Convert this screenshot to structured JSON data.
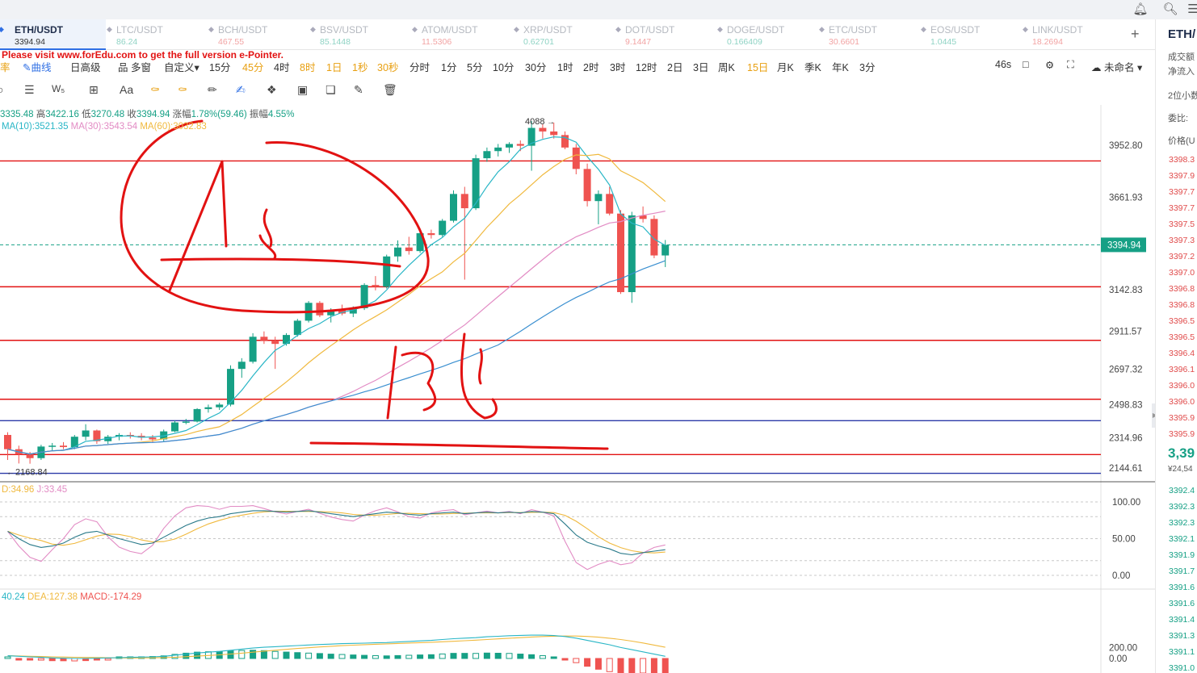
{
  "promo_text": "Please visit www.forEdu.com to get the full version e-Pointer.",
  "tabs": [
    {
      "symbol": "ETH/USDT",
      "price": "3394.94",
      "active": true
    },
    {
      "symbol": "LTC/USDT",
      "price": "86.24"
    },
    {
      "symbol": "BCH/USDT",
      "price": "467.55"
    },
    {
      "symbol": "BSV/USDT",
      "price": "85.1448"
    },
    {
      "symbol": "ATOM/USDT",
      "price": "11.5306"
    },
    {
      "symbol": "XRP/USDT",
      "price": "0.62701"
    },
    {
      "symbol": "DOT/USDT",
      "price": "9.1447"
    },
    {
      "symbol": "DOGE/USDT",
      "price": "0.166409"
    },
    {
      "symbol": "ETC/USDT",
      "price": "30.6601"
    },
    {
      "symbol": "EOS/USDT",
      "price": "1.0445"
    },
    {
      "symbol": "LINK/USDT",
      "price": "18.2694"
    }
  ],
  "intervals": {
    "left_partial": "率",
    "curve": "曲线",
    "advanced": "日高级",
    "multi": "品 多窗",
    "custom": "自定义",
    "items": [
      "15分",
      "45分",
      "4时",
      "8时",
      "1日",
      "1秒",
      "30秒",
      "分时",
      "1分",
      "5分",
      "10分",
      "30分",
      "1时",
      "2时",
      "3时",
      "12时",
      "2日",
      "3日",
      "周K",
      "15日",
      "月K",
      "季K",
      "年K",
      "3分"
    ],
    "highlighted": [
      "45分",
      "8时",
      "1日",
      "1秒",
      "30秒",
      "15日"
    ],
    "countdown": "46s",
    "layout_name": "未命名"
  },
  "ohlc_info": {
    "open": "3335.48",
    "high_label": "高",
    "high": "3422.16",
    "low_label": "低",
    "low": "3270.48",
    "close_label": "收",
    "close": "3394.94",
    "change_label": "涨幅",
    "change": "1.78%(59.46)",
    "amp_label": "振幅",
    "amp": "4.55%"
  },
  "ma_info": {
    "ma10": "MA(10):3521.35",
    "ma30": "MA(30):3543.54",
    "ma60": "MA(60):3032.83"
  },
  "kdj_info": {
    "d": "D:34.96",
    "j": "J:33.45"
  },
  "macd_info": {
    "dif": "40.24",
    "dea": "DEA:127.38",
    "macd": "MACD:-174.29"
  },
  "price_axis": [
    "3952.80",
    "3661.93",
    "3142.83",
    "2911.57",
    "2697.32",
    "2498.83",
    "2314.96",
    "2144.61"
  ],
  "current_price": "3394.94",
  "high_marker": "4088",
  "low_marker": "2168.84",
  "kdj_axis": [
    "100.00",
    "50.00",
    "0.00"
  ],
  "macd_axis": [
    "200.00",
    "0.00"
  ],
  "colors": {
    "up": "#16a085",
    "down": "#ef5350",
    "ma10": "#29b6c6",
    "ma30": "#f0b93e",
    "ma60": "#e28bc4",
    "annotation": "#e21212",
    "hline_blue": "#2b3aa8"
  },
  "right_panel": {
    "title": "ETH/",
    "labels": [
      "成交额",
      "净流入"
    ],
    "decimals": "2位小数",
    "commission": "委比:",
    "price_header": "价格(U",
    "asks": [
      "3398.3",
      "3397.9",
      "3397.7",
      "3397.7",
      "3397.5",
      "3397.3",
      "3397.2",
      "3397.0",
      "3396.8",
      "3396.8",
      "3396.5",
      "3396.5",
      "3396.4",
      "3396.1",
      "3396.0",
      "3396.0",
      "3395.9",
      "3395.9"
    ],
    "last": "3,39",
    "last_sub": "¥24,54",
    "bids": [
      "3392.4",
      "3392.3",
      "3392.3",
      "3392.1",
      "3391.9",
      "3391.7",
      "3391.6",
      "3391.6",
      "3391.4",
      "3391.3",
      "3391.1",
      "3391.0"
    ]
  },
  "chart_data": {
    "type": "candlestick",
    "symbol": "ETH/USDT",
    "candles": [
      {
        "o": 2330,
        "h": 2345,
        "l": 2190,
        "c": 2250
      },
      {
        "o": 2250,
        "h": 2270,
        "l": 2170,
        "c": 2220
      },
      {
        "o": 2220,
        "h": 2235,
        "l": 2168.84,
        "c": 2200
      },
      {
        "o": 2200,
        "h": 2275,
        "l": 2190,
        "c": 2265
      },
      {
        "o": 2265,
        "h": 2285,
        "l": 2240,
        "c": 2270
      },
      {
        "o": 2270,
        "h": 2290,
        "l": 2250,
        "c": 2262
      },
      {
        "o": 2262,
        "h": 2330,
        "l": 2250,
        "c": 2320
      },
      {
        "o": 2320,
        "h": 2390,
        "l": 2300,
        "c": 2355
      },
      {
        "o": 2355,
        "h": 2360,
        "l": 2280,
        "c": 2295
      },
      {
        "o": 2295,
        "h": 2330,
        "l": 2280,
        "c": 2320
      },
      {
        "o": 2320,
        "h": 2340,
        "l": 2300,
        "c": 2330
      },
      {
        "o": 2330,
        "h": 2345,
        "l": 2310,
        "c": 2325
      },
      {
        "o": 2325,
        "h": 2340,
        "l": 2300,
        "c": 2315
      },
      {
        "o": 2315,
        "h": 2330,
        "l": 2290,
        "c": 2305
      },
      {
        "o": 2305,
        "h": 2360,
        "l": 2290,
        "c": 2350
      },
      {
        "o": 2350,
        "h": 2410,
        "l": 2345,
        "c": 2400
      },
      {
        "o": 2400,
        "h": 2420,
        "l": 2390,
        "c": 2405
      },
      {
        "o": 2405,
        "h": 2480,
        "l": 2400,
        "c": 2475
      },
      {
        "o": 2475,
        "h": 2500,
        "l": 2455,
        "c": 2485
      },
      {
        "o": 2485,
        "h": 2510,
        "l": 2470,
        "c": 2500
      },
      {
        "o": 2500,
        "h": 2720,
        "l": 2490,
        "c": 2700
      },
      {
        "o": 2700,
        "h": 2760,
        "l": 2650,
        "c": 2740
      },
      {
        "o": 2740,
        "h": 2900,
        "l": 2730,
        "c": 2880
      },
      {
        "o": 2880,
        "h": 2910,
        "l": 2840,
        "c": 2860
      },
      {
        "o": 2860,
        "h": 2880,
        "l": 2700,
        "c": 2840
      },
      {
        "o": 2840,
        "h": 2900,
        "l": 2830,
        "c": 2890
      },
      {
        "o": 2890,
        "h": 2980,
        "l": 2880,
        "c": 2970
      },
      {
        "o": 2970,
        "h": 3080,
        "l": 2960,
        "c": 3070
      },
      {
        "o": 3070,
        "h": 3080,
        "l": 2990,
        "c": 3000
      },
      {
        "o": 3000,
        "h": 3040,
        "l": 2960,
        "c": 3030
      },
      {
        "o": 3030,
        "h": 3060,
        "l": 3000,
        "c": 3010
      },
      {
        "o": 3010,
        "h": 3050,
        "l": 2990,
        "c": 3040
      },
      {
        "o": 3040,
        "h": 3180,
        "l": 3030,
        "c": 3170
      },
      {
        "o": 3170,
        "h": 3220,
        "l": 3140,
        "c": 3160
      },
      {
        "o": 3160,
        "h": 3340,
        "l": 3150,
        "c": 3330
      },
      {
        "o": 3330,
        "h": 3420,
        "l": 3300,
        "c": 3380
      },
      {
        "o": 3380,
        "h": 3440,
        "l": 3340,
        "c": 3360
      },
      {
        "o": 3360,
        "h": 3470,
        "l": 3350,
        "c": 3460
      },
      {
        "o": 3460,
        "h": 3480,
        "l": 3430,
        "c": 3450
      },
      {
        "o": 3450,
        "h": 3540,
        "l": 3440,
        "c": 3530
      },
      {
        "o": 3530,
        "h": 3700,
        "l": 3520,
        "c": 3680
      },
      {
        "o": 3680,
        "h": 3720,
        "l": 3200,
        "c": 3600
      },
      {
        "o": 3600,
        "h": 3900,
        "l": 3590,
        "c": 3880
      },
      {
        "o": 3880,
        "h": 3940,
        "l": 3860,
        "c": 3920
      },
      {
        "o": 3920,
        "h": 3960,
        "l": 3890,
        "c": 3940
      },
      {
        "o": 3940,
        "h": 3970,
        "l": 3910,
        "c": 3960
      },
      {
        "o": 3960,
        "h": 3980,
        "l": 3920,
        "c": 3950
      },
      {
        "o": 3950,
        "h": 4088,
        "l": 3810,
        "c": 4050
      },
      {
        "o": 4050,
        "h": 4070,
        "l": 3990,
        "c": 4030
      },
      {
        "o": 4030,
        "h": 4080,
        "l": 3990,
        "c": 4010
      },
      {
        "o": 4010,
        "h": 4030,
        "l": 3930,
        "c": 3940
      },
      {
        "o": 3940,
        "h": 3960,
        "l": 3790,
        "c": 3820
      },
      {
        "o": 3820,
        "h": 3850,
        "l": 3610,
        "c": 3640
      },
      {
        "o": 3640,
        "h": 3700,
        "l": 3510,
        "c": 3680
      },
      {
        "o": 3680,
        "h": 3720,
        "l": 3560,
        "c": 3570
      },
      {
        "o": 3570,
        "h": 3590,
        "l": 3120,
        "c": 3130
      },
      {
        "o": 3130,
        "h": 3580,
        "l": 3070,
        "c": 3560
      },
      {
        "o": 3560,
        "h": 3610,
        "l": 3520,
        "c": 3540
      },
      {
        "o": 3540,
        "h": 3560,
        "l": 3320,
        "c": 3335.48
      },
      {
        "o": 3335.48,
        "h": 3422.16,
        "l": 3270.48,
        "c": 3394.94
      }
    ],
    "horizontal_lines": [
      {
        "price": 3865,
        "color": "red"
      },
      {
        "price": 3160,
        "color": "red"
      },
      {
        "price": 2860,
        "color": "red"
      },
      {
        "price": 2530,
        "color": "red"
      },
      {
        "price": 2410,
        "color": "blue"
      },
      {
        "price": 2220,
        "color": "red"
      },
      {
        "price": 2115,
        "color": "blue"
      }
    ],
    "kdj": {
      "k": [
        60,
        50,
        42,
        38,
        40,
        44,
        52,
        58,
        60,
        55,
        50,
        46,
        42,
        44,
        52,
        60,
        68,
        74,
        78,
        80,
        84,
        86,
        88,
        88,
        87,
        86,
        87,
        88,
        86,
        84,
        82,
        80,
        82,
        84,
        86,
        85,
        83,
        82,
        84,
        85,
        86,
        84,
        85,
        86,
        85,
        86,
        85,
        87,
        86,
        84,
        70,
        55,
        45,
        40,
        36,
        30,
        28,
        31,
        33,
        34.96
      ]
    },
    "macd": {
      "dif": [
        50,
        40,
        30,
        20,
        10,
        5,
        0,
        0,
        5,
        10,
        15,
        20,
        25,
        30,
        40,
        60,
        80,
        100,
        115,
        130,
        150,
        170,
        190,
        205,
        215,
        225,
        235,
        245,
        255,
        262,
        270,
        275,
        280,
        285,
        290,
        300,
        310,
        320,
        330,
        345,
        360,
        370,
        380,
        395,
        405,
        415,
        420,
        425,
        425,
        418,
        400,
        370,
        330,
        290,
        250,
        200,
        160,
        120,
        80,
        40.24
      ]
    }
  }
}
